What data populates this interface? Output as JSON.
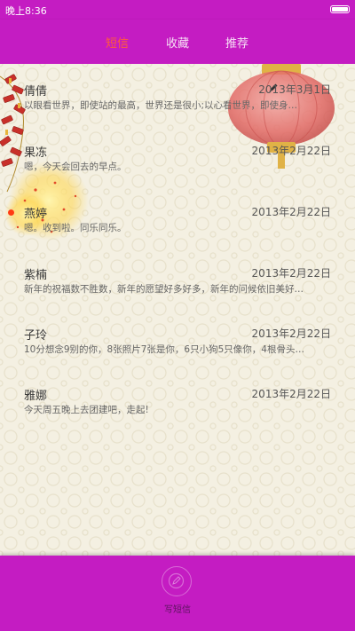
{
  "status_bar": {
    "time": "晚上8:36"
  },
  "tabs": [
    {
      "label": "短信",
      "active": true
    },
    {
      "label": "收藏",
      "active": false
    },
    {
      "label": "推荐",
      "active": false
    }
  ],
  "messages": [
    {
      "name": "倩倩",
      "date": "2013年3月1日",
      "preview": "以眼看世界，即使站的最高，世界还是很小;以心看世界，即使身…"
    },
    {
      "name": "果冻",
      "date": "2013年2月22日",
      "preview": "嗯，今天会回去的早点。"
    },
    {
      "name": "燕婷",
      "date": "2013年2月22日",
      "preview": "嗯。收到啦。同乐同乐。",
      "unread": true
    },
    {
      "name": "紫楠",
      "date": "2013年2月22日",
      "preview": "新年的祝福数不胜数，新年的愿望好多好多，新年的问候依旧美好…"
    },
    {
      "name": "子玲",
      "date": "2013年2月22日",
      "preview": "10分想念9别的你，8张照片7张是你，6只小狗5只像你，4根骨头…"
    },
    {
      "name": "雅娜",
      "date": "2013年2月22日",
      "preview": "今天周五晚上去团建吧，走起!"
    }
  ],
  "bottom_bar": {
    "compose_label": "写短信"
  },
  "colors": {
    "brand": "#c41cc2",
    "active_tab": "#ff5b3c",
    "background": "#f4f0e2",
    "unread_dot": "#ff3b14"
  }
}
